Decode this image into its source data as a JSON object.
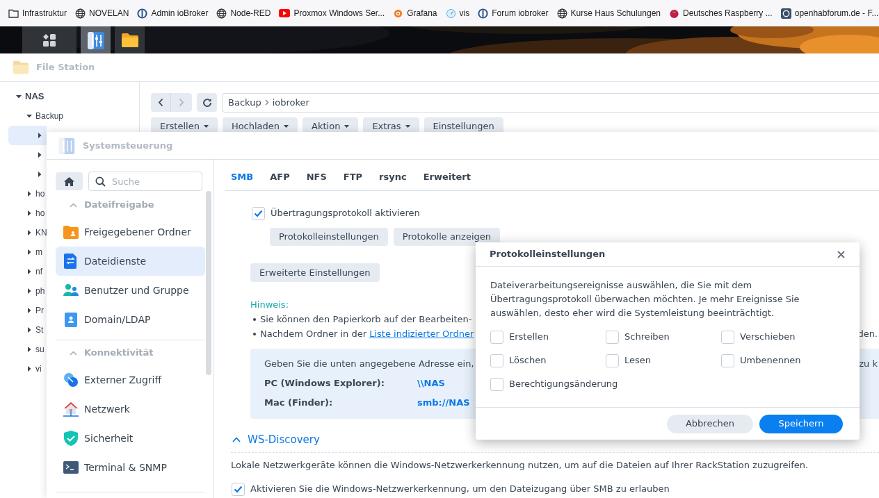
{
  "bookmarks": [
    {
      "label": "Infrastruktur",
      "kind": "folder"
    },
    {
      "label": "NOVELAN",
      "kind": "globe"
    },
    {
      "label": "Admin ioBroker",
      "kind": "iobroker"
    },
    {
      "label": "Node-RED",
      "kind": "globe"
    },
    {
      "label": "Proxmox Windows Ser...",
      "kind": "video"
    },
    {
      "label": "Grafana",
      "kind": "grafana"
    },
    {
      "label": "vis",
      "kind": "gauge"
    },
    {
      "label": "Forum iobroker",
      "kind": "iobroker"
    },
    {
      "label": "Kurse Haus Schulungen",
      "kind": "globe"
    },
    {
      "label": "Deutsches Raspberry ...",
      "kind": "raspberry"
    },
    {
      "label": "openhabforum.de - F...",
      "kind": "openhab"
    }
  ],
  "taskbar": [
    {
      "kind": "apps",
      "selected": false
    },
    {
      "kind": "control-panel",
      "selected": true
    },
    {
      "kind": "file-station",
      "selected": false
    }
  ],
  "file_station": {
    "title": "File Station",
    "tree": [
      {
        "label": "NAS",
        "expanded": true,
        "selected": false,
        "children": [
          {
            "label": "Backup",
            "expanded": true,
            "selected": false,
            "children": [
              {
                "expanded": false,
                "selected": true
              },
              {
                "expanded": false,
                "selected": false
              },
              {
                "expanded": false,
                "selected": false
              }
            ]
          },
          {
            "label": "ho",
            "expanded": false,
            "selected": false
          },
          {
            "label": "ho",
            "expanded": false,
            "selected": false
          },
          {
            "label": "KN",
            "expanded": false,
            "selected": false
          },
          {
            "label": "m",
            "expanded": false,
            "selected": false
          },
          {
            "label": "nf",
            "expanded": false,
            "selected": false
          },
          {
            "label": "ph",
            "expanded": false,
            "selected": false
          },
          {
            "label": "Pr",
            "expanded": false,
            "selected": false
          },
          {
            "label": "St",
            "expanded": false,
            "selected": false
          },
          {
            "label": "su",
            "expanded": false,
            "selected": false
          },
          {
            "label": "vi",
            "expanded": false,
            "selected": false
          }
        ]
      }
    ],
    "path": [
      "Backup",
      "iobroker"
    ],
    "toolbar": [
      {
        "label": "Erstellen",
        "dropdown": true
      },
      {
        "label": "Hochladen",
        "dropdown": true
      },
      {
        "label": "Aktion",
        "dropdown": true
      },
      {
        "label": "Extras",
        "dropdown": true
      },
      {
        "label": "Einstellungen",
        "dropdown": false
      }
    ]
  },
  "control_panel": {
    "title": "Systemsteuerung",
    "search": {
      "placeholder": "Suche"
    },
    "sections": [
      {
        "title": "Dateifreigabe",
        "expanded": true,
        "items": [
          {
            "label": "Freigegebener Ordner",
            "kind": "shared-folder",
            "selected": false
          },
          {
            "label": "Dateidienste",
            "kind": "file-services",
            "selected": true
          },
          {
            "label": "Benutzer und Gruppe",
            "kind": "users",
            "selected": false
          },
          {
            "label": "Domain/LDAP",
            "kind": "domain",
            "selected": false
          }
        ]
      },
      {
        "title": "Konnektivität",
        "expanded": true,
        "items": [
          {
            "label": "Externer Zugriff",
            "kind": "external-access",
            "selected": false
          },
          {
            "label": "Netzwerk",
            "kind": "network",
            "selected": false
          },
          {
            "label": "Sicherheit",
            "kind": "security",
            "selected": false
          },
          {
            "label": "Terminal & SNMP",
            "kind": "terminal",
            "selected": false
          }
        ]
      }
    ],
    "tabs": [
      {
        "label": "SMB",
        "selected": true
      },
      {
        "label": "AFP",
        "selected": false
      },
      {
        "label": "NFS",
        "selected": false
      },
      {
        "label": "FTP",
        "selected": false
      },
      {
        "label": "rsync",
        "selected": false
      },
      {
        "label": "Erweitert",
        "selected": false
      }
    ],
    "content": {
      "log_checkbox": {
        "label": "Übertragungsprotokoll aktivieren",
        "checked": true
      },
      "log_buttons": [
        "Protokolleinstellungen",
        "Protokolle anzeigen"
      ],
      "advanced_button": "Erweiterte Einstellungen",
      "note": {
        "title": "Hinweis:",
        "bullets": [
          {
            "text": "Sie können den Papierkorb auf der Bearbeiten-"
          },
          {
            "text": "Nachdem Ordner in der",
            "link": "Liste indizierter Ordner",
            "tail": "den."
          }
        ]
      },
      "address_box": {
        "intro": "Geben Sie die unten angegebene Adresse ein,",
        "intro_tail": "zu k",
        "rows": [
          {
            "label": "PC (Windows Explorer):",
            "value": "\\\\NAS"
          },
          {
            "label": "Mac (Finder):",
            "value": "smb://NAS"
          }
        ]
      },
      "ws_discovery": {
        "title": "WS-Discovery",
        "expanded": true,
        "description": "Lokale Netzwerkgeräte können die Windows-Netzwerkerkennung nutzen, um auf die Dateien auf Ihrer RackStation zuzugreifen.",
        "checkbox": {
          "label": "Aktivieren Sie die Windows-Netzwerkerkennung, um den Dateizugang über SMB zu erlauben",
          "checked": true
        }
      }
    }
  },
  "dialog": {
    "title": "Protokolleinstellungen",
    "description": "Dateiverarbeitungsereignisse auswählen, die Sie mit dem Übertragungsprotokoll überwachen möchten. Je mehr Ereignisse Sie auswählen, desto eher wird die Systemleistung beeinträchtigt.",
    "events": [
      {
        "label": "Erstellen",
        "checked": false
      },
      {
        "label": "Schreiben",
        "checked": false
      },
      {
        "label": "Verschieben",
        "checked": false
      },
      {
        "label": "Löschen",
        "checked": false
      },
      {
        "label": "Lesen",
        "checked": false
      },
      {
        "label": "Umbenennen",
        "checked": false
      },
      {
        "label": "Berechtigungsänderung",
        "checked": false
      }
    ],
    "buttons": [
      {
        "label": "Abbrechen",
        "kind": "secondary"
      },
      {
        "label": "Speichern",
        "kind": "primary"
      }
    ]
  }
}
